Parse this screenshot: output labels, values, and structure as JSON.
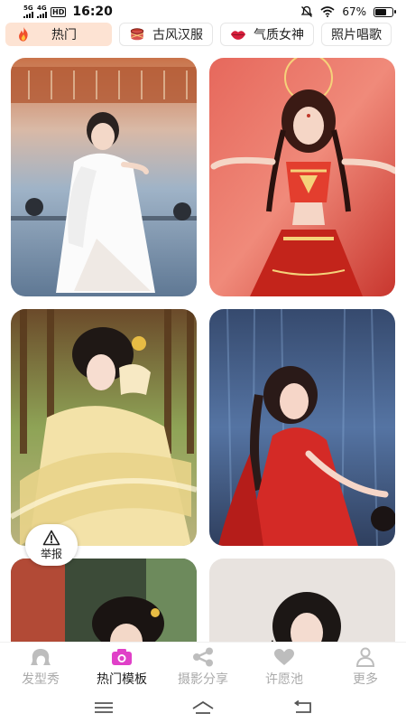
{
  "status_bar": {
    "network_1": "5G",
    "network_2": "4G",
    "hd": "HD",
    "time": "16:20",
    "battery": "67%",
    "battery_level": 0.67
  },
  "category_tabs": [
    {
      "label": "热门",
      "icon": "fire-icon",
      "active": true
    },
    {
      "label": "古风汉服",
      "icon": "drum-icon",
      "active": false
    },
    {
      "label": "气质女神",
      "icon": "lips-icon",
      "active": false
    },
    {
      "label": "照片唱歌",
      "icon": "none",
      "active": false
    }
  ],
  "report_button": {
    "label": "举报",
    "icon": "warning-icon"
  },
  "bottom_nav": [
    {
      "label": "发型秀",
      "icon": "hairstyle-icon",
      "active": false
    },
    {
      "label": "热门模板",
      "icon": "camera-icon",
      "active": true
    },
    {
      "label": "摄影分享",
      "icon": "share-icon",
      "active": false
    },
    {
      "label": "许愿池",
      "icon": "heart-icon",
      "active": false
    },
    {
      "label": "更多",
      "icon": "person-icon",
      "active": false
    }
  ],
  "colors": {
    "accent": "#e040c8",
    "active_tab_bg": "#fde3d3",
    "inactive_nav": "#aaaaaa"
  }
}
